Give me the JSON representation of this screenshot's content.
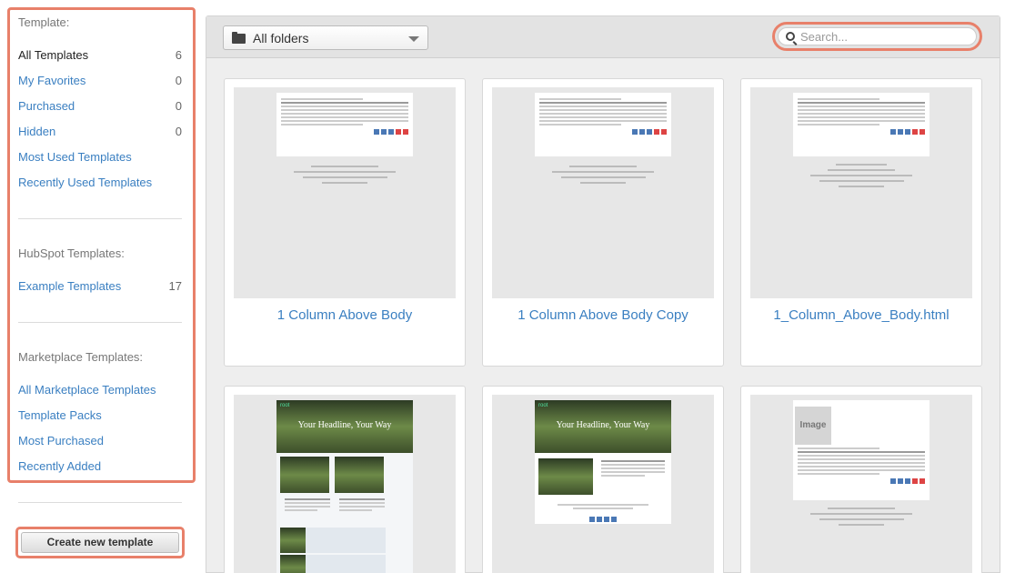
{
  "sidebar": {
    "template_heading": "Template:",
    "template_items": [
      {
        "label": "All Templates",
        "count": "6"
      },
      {
        "label": "My Favorites",
        "count": "0"
      },
      {
        "label": "Purchased",
        "count": "0"
      },
      {
        "label": "Hidden",
        "count": "0"
      },
      {
        "label": "Most Used Templates",
        "count": ""
      },
      {
        "label": "Recently Used Templates",
        "count": ""
      }
    ],
    "hubspot_heading": "HubSpot Templates:",
    "hubspot_items": [
      {
        "label": "Example Templates",
        "count": "17"
      }
    ],
    "marketplace_heading": "Marketplace Templates:",
    "marketplace_items": [
      {
        "label": "All Marketplace Templates"
      },
      {
        "label": "Template Packs"
      },
      {
        "label": "Most Purchased"
      },
      {
        "label": "Recently Added"
      }
    ],
    "create_button": "Create new template"
  },
  "toolbar": {
    "folder_select": "All folders",
    "search_placeholder": "Search..."
  },
  "cards": [
    {
      "title": "1 Column Above Body"
    },
    {
      "title": "1 Column Above Body Copy"
    },
    {
      "title": "1_Column_Above_Body.html"
    },
    {
      "title": ""
    },
    {
      "title": ""
    },
    {
      "title": ""
    }
  ],
  "thumbnails": {
    "headline": "Your Headline, Your Way",
    "logo": "root",
    "image_placeholder": "Image"
  },
  "colors": {
    "highlight": "#e8806a",
    "link": "#3a7fc1"
  }
}
